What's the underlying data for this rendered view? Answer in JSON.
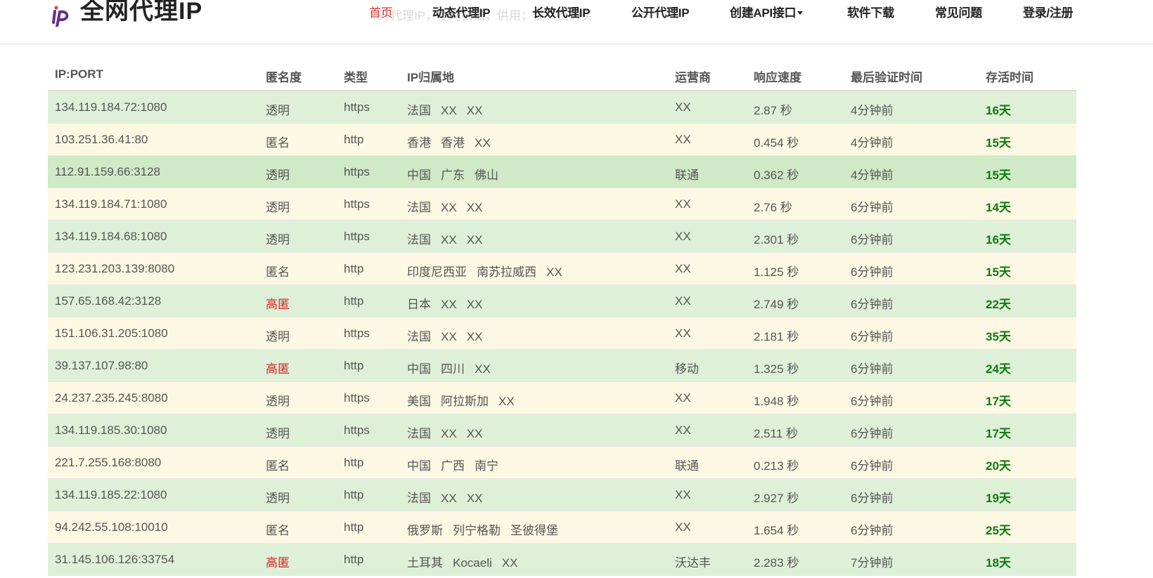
{
  "brand": {
    "title": "全网代理IP",
    "logo_icon": "ip-logo-icon",
    "logo_accent": "#6b2c8a"
  },
  "header": {
    "ghost_text": "开代理IP，全网扫描，供用；仅…费购买",
    "nav": [
      {
        "label": "首页",
        "active": true
      },
      {
        "label": "动态代理IP"
      },
      {
        "label": "长效代理IP"
      },
      {
        "label": "公开代理IP"
      },
      {
        "label": "创建API接口",
        "dropdown": true
      },
      {
        "label": "软件下载"
      },
      {
        "label": "常见问题"
      },
      {
        "label": "登录/注册"
      }
    ]
  },
  "table": {
    "columns": [
      "IP:PORT",
      "匿名度",
      "类型",
      "IP归属地",
      "运营商",
      "响应速度",
      "最后验证时间",
      "存活时间"
    ],
    "rows": [
      {
        "ip": "134.119.184.72:1080",
        "anon": "透明",
        "type": "https",
        "loc": [
          "法国",
          "XX",
          "XX"
        ],
        "isp": "XX",
        "speed": "2.87 秒",
        "verified": "4分钟前",
        "alive": "16天"
      },
      {
        "ip": "103.251.36.41:80",
        "anon": "匿名",
        "type": "http",
        "loc": [
          "香港",
          "香港",
          "XX"
        ],
        "isp": "XX",
        "speed": "0.454 秒",
        "verified": "4分钟前",
        "alive": "15天"
      },
      {
        "ip": "112.91.159.66:3128",
        "anon": "透明",
        "type": "https",
        "loc": [
          "中国",
          "广东",
          "佛山"
        ],
        "isp": "联通",
        "speed": "0.362 秒",
        "verified": "4分钟前",
        "alive": "15天"
      },
      {
        "ip": "134.119.184.71:1080",
        "anon": "透明",
        "type": "https",
        "loc": [
          "法国",
          "XX",
          "XX"
        ],
        "isp": "XX",
        "speed": "2.76 秒",
        "verified": "6分钟前",
        "alive": "14天"
      },
      {
        "ip": "134.119.184.68:1080",
        "anon": "透明",
        "type": "https",
        "loc": [
          "法国",
          "XX",
          "XX"
        ],
        "isp": "XX",
        "speed": "2.301 秒",
        "verified": "6分钟前",
        "alive": "16天"
      },
      {
        "ip": "123.231.203.139:8080",
        "anon": "匿名",
        "type": "http",
        "loc": [
          "印度尼西亚",
          "南苏拉威西",
          "XX"
        ],
        "isp": "XX",
        "speed": "1.125 秒",
        "verified": "6分钟前",
        "alive": "15天"
      },
      {
        "ip": "157.65.168.42:3128",
        "anon": "高匿",
        "type": "http",
        "loc": [
          "日本",
          "XX",
          "XX"
        ],
        "isp": "XX",
        "speed": "2.749 秒",
        "verified": "6分钟前",
        "alive": "22天"
      },
      {
        "ip": "151.106.31.205:1080",
        "anon": "透明",
        "type": "https",
        "loc": [
          "法国",
          "XX",
          "XX"
        ],
        "isp": "XX",
        "speed": "2.181 秒",
        "verified": "6分钟前",
        "alive": "35天"
      },
      {
        "ip": "39.137.107.98:80",
        "anon": "高匿",
        "type": "http",
        "loc": [
          "中国",
          "四川",
          "XX"
        ],
        "isp": "移动",
        "speed": "1.325 秒",
        "verified": "6分钟前",
        "alive": "24天"
      },
      {
        "ip": "24.237.235.245:8080",
        "anon": "透明",
        "type": "https",
        "loc": [
          "美国",
          "阿拉斯加",
          "XX"
        ],
        "isp": "XX",
        "speed": "1.948 秒",
        "verified": "6分钟前",
        "alive": "17天"
      },
      {
        "ip": "134.119.185.30:1080",
        "anon": "透明",
        "type": "https",
        "loc": [
          "法国",
          "XX",
          "XX"
        ],
        "isp": "XX",
        "speed": "2.511 秒",
        "verified": "6分钟前",
        "alive": "17天"
      },
      {
        "ip": "221.7.255.168:8080",
        "anon": "匿名",
        "type": "http",
        "loc": [
          "中国",
          "广西",
          "南宁"
        ],
        "isp": "联通",
        "speed": "0.213 秒",
        "verified": "6分钟前",
        "alive": "20天"
      },
      {
        "ip": "134.119.185.22:1080",
        "anon": "透明",
        "type": "http",
        "loc": [
          "法国",
          "XX",
          "XX"
        ],
        "isp": "XX",
        "speed": "2.927 秒",
        "verified": "6分钟前",
        "alive": "19天"
      },
      {
        "ip": "94.242.55.108:10010",
        "anon": "匿名",
        "type": "http",
        "loc": [
          "俄罗斯",
          "列宁格勒",
          "圣彼得堡"
        ],
        "isp": "XX",
        "speed": "1.654 秒",
        "verified": "6分钟前",
        "alive": "25天"
      },
      {
        "ip": "31.145.106.126:33754",
        "anon": "高匿",
        "type": "http",
        "loc": [
          "土耳其",
          "Kocaeli",
          "XX"
        ],
        "isp": "沃达丰",
        "speed": "2.283 秒",
        "verified": "7分钟前",
        "alive": "18天"
      }
    ]
  },
  "colors": {
    "row_green": "#dff0d8",
    "row_cream": "#fcf8e3",
    "active_nav": "#d9332e",
    "high_anon": "#e02020",
    "alive_text": "#0e7a0e"
  }
}
